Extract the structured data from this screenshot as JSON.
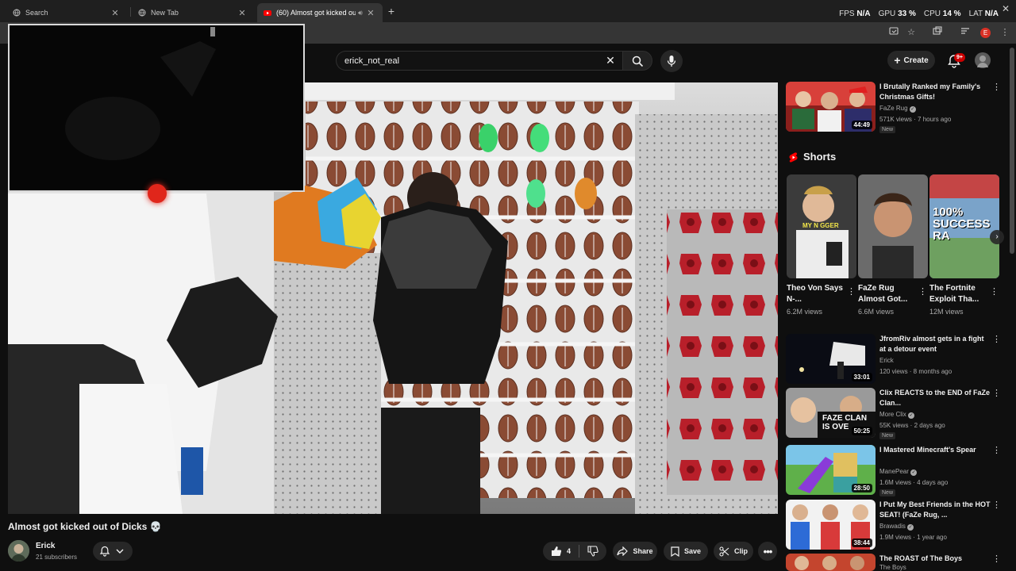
{
  "browser": {
    "tabs": [
      {
        "label": "Search"
      },
      {
        "label": "New Tab"
      },
      {
        "label": "(60) Almost got kicked out",
        "active": true
      }
    ],
    "perf": {
      "fps_label": "FPS",
      "fps_value": "N/A",
      "gpu_label": "GPU",
      "gpu_value": "33 %",
      "cpu_label": "CPU",
      "cpu_value": "14 %",
      "lat_label": "LAT",
      "lat_value": "N/A"
    },
    "profile_initial": "E"
  },
  "masthead": {
    "search_value": "erick_not_real",
    "create_label": "Create",
    "notification_count": "9+"
  },
  "video": {
    "title": "Almost got kicked out of Dicks 💀",
    "channel": "Erick",
    "subscribers": "21 subscribers",
    "likes": "4",
    "share_label": "Share",
    "save_label": "Save",
    "clip_label": "Clip"
  },
  "sidebar": {
    "top_video": {
      "title": "I Brutally Ranked my Family's Christmas Gifts!",
      "channel": "FaZe Rug",
      "meta": "571K views · 7 hours ago",
      "badge": "New",
      "duration": "44:49"
    },
    "shorts_title": "Shorts",
    "shorts": [
      {
        "title": "Theo Von Says N-...",
        "views": "6.2M views",
        "overlay": "MY N GGER"
      },
      {
        "title": "FaZe Rug Almost Got...",
        "views": "6.6M views",
        "overlay": ""
      },
      {
        "title": "The Fortnite Exploit Tha...",
        "views": "12M views",
        "overlay": "100% SUCCESS RA"
      }
    ],
    "videos": [
      {
        "title": "JfromRiv almost gets in a fight at a detour event",
        "channel": "Erick",
        "meta": "120 views · 8 months ago",
        "duration": "33:01",
        "badge": ""
      },
      {
        "title": "Clix REACTS to the END of FaZe Clan...",
        "channel": "More Clix",
        "meta": "55K views · 2 days ago",
        "duration": "50:25",
        "badge": "New",
        "overlay": "FAZE CLAN IS OVE"
      },
      {
        "title": "I Mastered Minecraft's Spear",
        "channel": "ManePear",
        "meta": "1.6M views · 4 days ago",
        "duration": "28:50",
        "badge": "New"
      },
      {
        "title": "I Put My Best Friends in the HOT SEAT! (FaZe Rug, ...",
        "channel": "Brawadis",
        "meta": "1.9M views · 1 year ago",
        "duration": "38:44",
        "badge": ""
      },
      {
        "title": "The ROAST of The Boys",
        "channel": "The Boys",
        "meta": "",
        "duration": "",
        "badge": ""
      }
    ]
  },
  "colors": {
    "background": "#0f0f0f",
    "accent_red": "#ff0000",
    "surface": "#272727",
    "text_secondary": "#aaaaaa"
  }
}
